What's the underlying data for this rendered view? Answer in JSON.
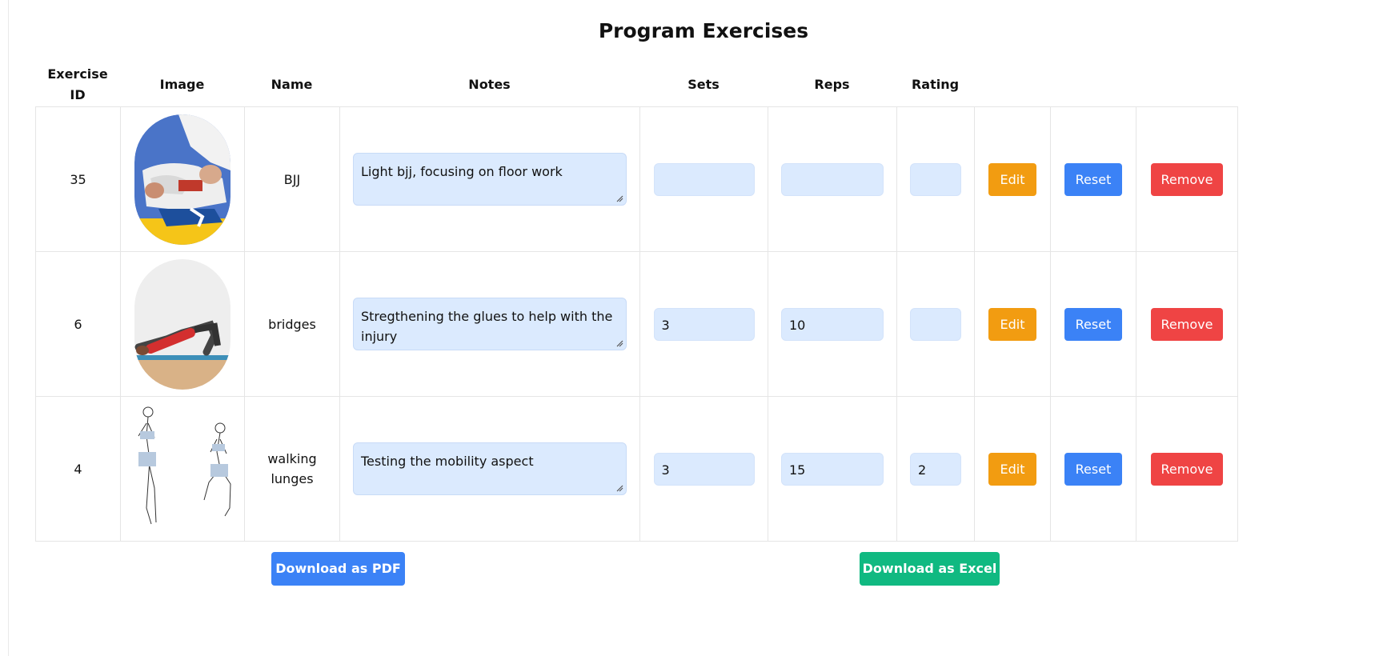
{
  "page": {
    "title": "Program Exercises"
  },
  "columns": {
    "exercise_id": [
      "Exercise",
      "ID"
    ],
    "image": "Image",
    "name": [
      "Name"
    ],
    "notes": "Notes",
    "sets": "Sets",
    "reps": "Reps",
    "rating": "Rating"
  },
  "rows": [
    {
      "id": "35",
      "name": [
        "BJJ"
      ],
      "image": "bjj-photo",
      "notes": [
        "Light bjj, focusing on floor work"
      ],
      "sets": "",
      "reps": "",
      "rating": "",
      "edit": "Edit",
      "reset": "Reset",
      "remove": "Remove"
    },
    {
      "id": "6",
      "name": [
        "bridges"
      ],
      "image": "glute-bridge-photo",
      "notes": [
        "Stregthening the glues to help with the",
        "injury"
      ],
      "sets": "3",
      "reps": "10",
      "rating": "",
      "edit": "Edit",
      "reset": "Reset",
      "remove": "Remove"
    },
    {
      "id": "4",
      "name": [
        "walking",
        "lunges"
      ],
      "image": "lunge-sketch",
      "notes": [
        "Testing the mobility aspect"
      ],
      "sets": "3",
      "reps": "15",
      "rating": "2",
      "edit": "Edit",
      "reset": "Reset",
      "remove": "Remove"
    }
  ],
  "actions": {
    "download_pdf": "Download as PDF",
    "download_excel": "Download as Excel"
  },
  "colors": {
    "edit": "#f29c11",
    "reset": "#3b82f6",
    "remove": "#ef4444",
    "excel": "#10b981",
    "input_bg": "#dbeafe"
  }
}
